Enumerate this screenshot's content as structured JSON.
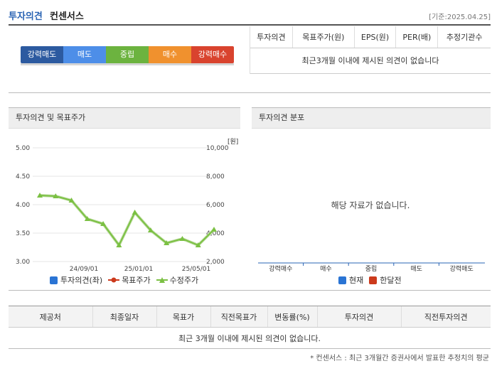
{
  "header": {
    "title_part1": "투자의견",
    "title_part2": "컨센서스",
    "date": "[기준:2025.04.25]"
  },
  "gauge": {
    "levels": [
      "강력매도",
      "매도",
      "중립",
      "매수",
      "강력매수"
    ]
  },
  "opinion_table": {
    "headers": [
      "투자의견",
      "목표주가(원)",
      "EPS(원)",
      "PER(배)",
      "추정기관수"
    ],
    "empty_message": "최근3개월 이내에 제시된 의견이 없습니다"
  },
  "left_panel": {
    "title": "투자의견 및 목표주가",
    "unit": "[원]"
  },
  "right_panel": {
    "title": "투자의견 분포",
    "nodata": "해당 자료가 없습니다."
  },
  "chart_data": [
    {
      "type": "line",
      "y_left_ticks": [
        "5.00",
        "4.50",
        "4.00",
        "3.50",
        "3.00"
      ],
      "y_right_ticks": [
        "10,000",
        "8,000",
        "6,000",
        "4,000",
        "2,000"
      ],
      "x_ticks": [
        "24/09/01",
        "25/01/01",
        "25/05/01"
      ],
      "ylim_right": [
        2000,
        10000
      ],
      "series": [
        {
          "name": "수정주가",
          "values": [
            6650,
            6600,
            6300,
            5000,
            4650,
            3150,
            5450,
            4200,
            3300,
            3600,
            3150,
            4250
          ]
        }
      ],
      "legend": [
        "투자의견(좌)",
        "목표주가",
        "수정주가"
      ],
      "legend_colors": [
        "#2a74d4",
        "#cc3a1c",
        "#7bc043"
      ]
    },
    {
      "type": "bar",
      "categories": [
        "강력매수",
        "매수",
        "중립",
        "매도",
        "강력매도"
      ],
      "legend": [
        "현재",
        "한달전"
      ],
      "legend_colors": [
        "#2a74d4",
        "#cc3a1c"
      ]
    }
  ],
  "bottom_table": {
    "headers": [
      "제공처",
      "최종일자",
      "목표가",
      "직전목표가",
      "변동률(%)",
      "투자의견",
      "직전투자의견"
    ],
    "empty_message": "최근 3개월 이내에 제시된 의견이 없습니다."
  },
  "footnote": "* 컨센서스 : 최근 3개월간 증권사에서 발표한 추정치의 평균"
}
